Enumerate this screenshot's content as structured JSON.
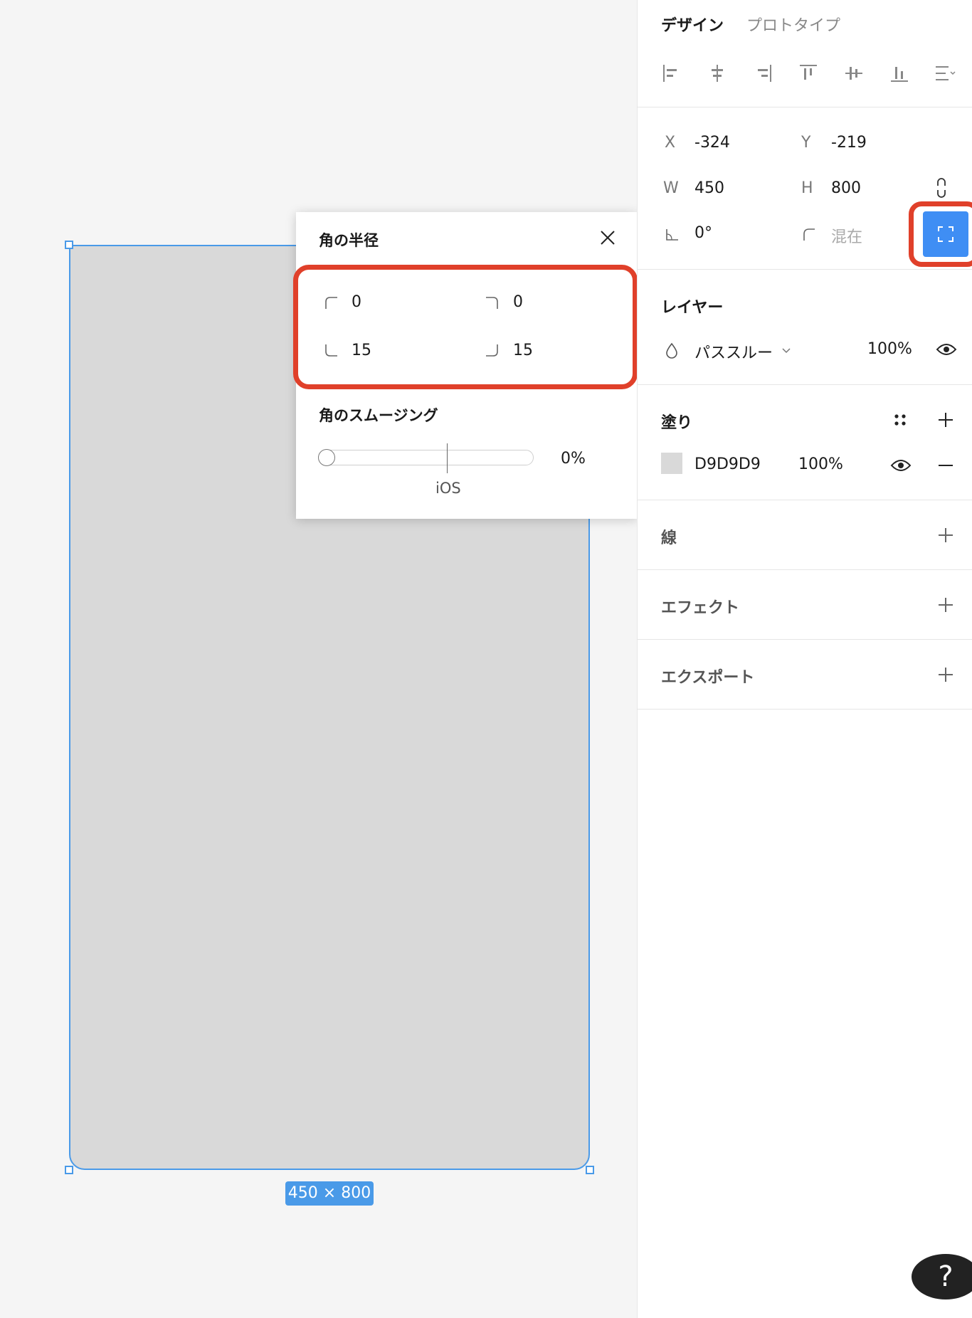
{
  "canvas": {
    "frame_size_label": "450 × 800",
    "help_label": "?"
  },
  "popup": {
    "title": "角の半径",
    "corners": {
      "top_left": "0",
      "top_right": "0",
      "bottom_left": "15",
      "bottom_right": "15"
    },
    "smoothing_title": "角のスムージング",
    "smoothing_value": "0%",
    "smoothing_marker_label": "iOS"
  },
  "panel": {
    "tabs": {
      "design": "デザイン",
      "prototype": "プロトタイプ"
    },
    "position": {
      "x_label": "X",
      "x_value": "-324",
      "y_label": "Y",
      "y_value": "-219",
      "w_label": "W",
      "w_value": "450",
      "h_label": "H",
      "h_value": "800",
      "rotation_value": "0°",
      "radius_value": "混在"
    },
    "layer": {
      "title": "レイヤー",
      "blend_mode": "パススルー",
      "opacity": "100%"
    },
    "fill": {
      "title": "塗り",
      "hex": "D9D9D9",
      "opacity": "100%"
    },
    "stroke": {
      "title": "線"
    },
    "effects": {
      "title": "エフェクト"
    },
    "export": {
      "title": "エクスポート"
    }
  },
  "colors": {
    "selection": "#4a9ae8",
    "fill": "#d9d9d9",
    "highlight_annotation": "#e0402a",
    "active_button": "#3f8ef4"
  }
}
